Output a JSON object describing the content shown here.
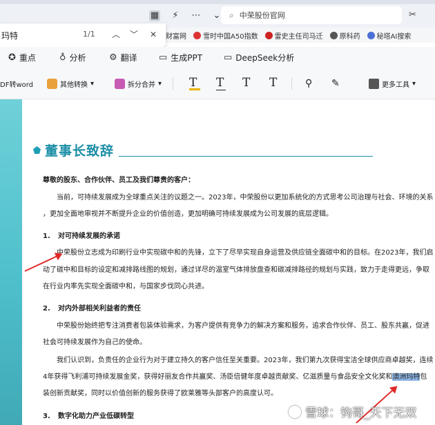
{
  "browser": {
    "address_text": "中荣股份官网",
    "bookmarks": [
      "财富网",
      "雪时中国A50指数",
      "雷史主任司马迁",
      "原科药",
      "秘塔AI搜索"
    ]
  },
  "findbar": {
    "query": "玛特",
    "count": "1/1"
  },
  "ai_toolbar": {
    "items": [
      "重点",
      "分析",
      "翻译",
      "生成PPT",
      "DeepSeek分析"
    ]
  },
  "pdf_toolbar": {
    "to_word": "DF转word",
    "other_convert": "其他转换",
    "split_merge": "拆分合并",
    "more_tools": "更多工具",
    "text_tool_glyph": "T"
  },
  "document": {
    "heading": "董事长致辞",
    "salutation": "尊敬的股东、合作伙伴、员工及我们尊贵的客户：",
    "intro_line1": "当前，可持续发展成为全球重点关注的议题之一。2023年，中荣股份以更加系统化的方式思考公司治理与社会、环境的关系",
    "intro_line2": "，更加全面地审视并不断提升企业的价值创造，更加明确可持续发展成为公司发展的底层逻辑。",
    "sec1_num": "1.",
    "sec1_title": "对可持续发展的承诺",
    "sec1_line1": "中荣股份立志成为印刷行业中实现碳中和的先锋，立下了尽早实现自身运营及供应链全面碳中和的目标。在2023年，我们启",
    "sec1_line2": "动了碳中和目标的设定和减排路线图的规划，通过详尽的温室气体排放盘查和碳减排路径的规划与实践，致力于走得更远，争取",
    "sec1_line3": "在行业内率先实现全面碳中和，与国家步伐同心共进。",
    "sec2_num": "2.",
    "sec2_title": "对内外部相关利益者的责任",
    "sec2_line1": "中荣股份始终把专注消费者包装体验需求，为客户提供有竞争力的解决方案和服务，追求合作伙伴、员工、股东共赢，促进",
    "sec2_line2": "社会可持续发展作为自己的使命。",
    "sec2_line3": "我们认识到，负责任的企业行为对于建立持久的客户信任至关重要。2023年，我们第九次获得宝洁全球供应商卓越奖，连续",
    "sec2_line4_pre": "4年获得飞利浦可持续发展金奖，获得好丽友合作共赢奖、汤臣倍健年度卓越贡献奖、亿滋质量与食品安全文化奖和",
    "sec2_line4_hl": "澳洲玛特",
    "sec2_line4_post": "包",
    "sec2_line5": "装创新贡献奖，同时以价值创新的服务获得了欧莱雅等头部客户的高度认可。",
    "sec3_num": "3.",
    "sec3_title": "数字化助力产业低碳转型"
  },
  "watermark": "雪球：钩哥_天下无双",
  "colors": {
    "heading": "#1b8ea6",
    "band": "#4ec0cc",
    "arrow": "#e02a2a",
    "highlight": "#8fb7e6"
  }
}
